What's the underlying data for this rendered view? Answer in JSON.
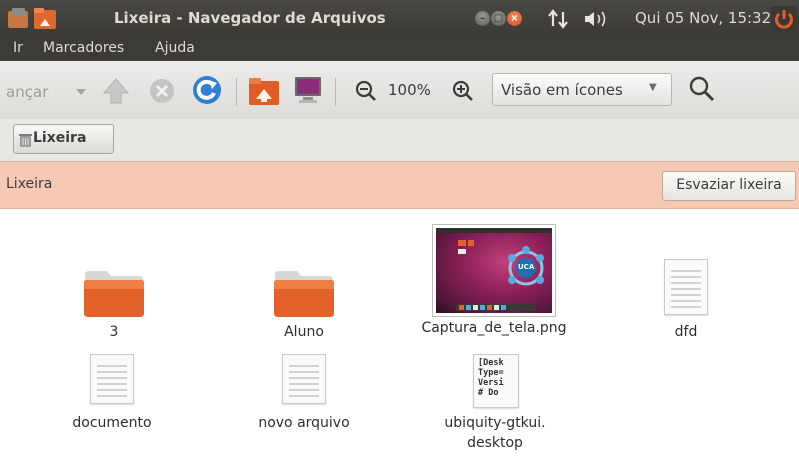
{
  "window": {
    "title": "Lixeira - Navegador de Arquivos",
    "clock": "Qui 05 Nov, 15:32"
  },
  "menu": {
    "items": [
      "Ir",
      "Marcadores",
      "Ajuda"
    ]
  },
  "toolbar": {
    "forward_label": "ançar",
    "zoom_level": "100%",
    "view_mode": "Visão em ícones"
  },
  "location": {
    "breadcrumb": "Lixeira"
  },
  "infobar": {
    "title": "Lixeira",
    "empty_button": "Esvaziar lixeira"
  },
  "files": [
    {
      "name": "3",
      "type": "folder"
    },
    {
      "name": "Aluno",
      "type": "folder"
    },
    {
      "name": "Captura_de_tela.png",
      "type": "image"
    },
    {
      "name": "dfd",
      "type": "text"
    },
    {
      "name": "documento",
      "type": "text"
    },
    {
      "name": "novo arquivo",
      "type": "text"
    },
    {
      "name": "ubiquity-gtkui.",
      "name_line2": "desktop",
      "type": "desktop",
      "preview_lines": [
        "[Desk",
        "Type=",
        "Versi",
        "# Do"
      ]
    }
  ],
  "thumbnail": {
    "badge": "UCA"
  },
  "colors": {
    "infobar": "#f5c9b3",
    "folder_orange": "#e2622a",
    "close_button": "#d14a1e",
    "panel": "#3c3b37"
  }
}
